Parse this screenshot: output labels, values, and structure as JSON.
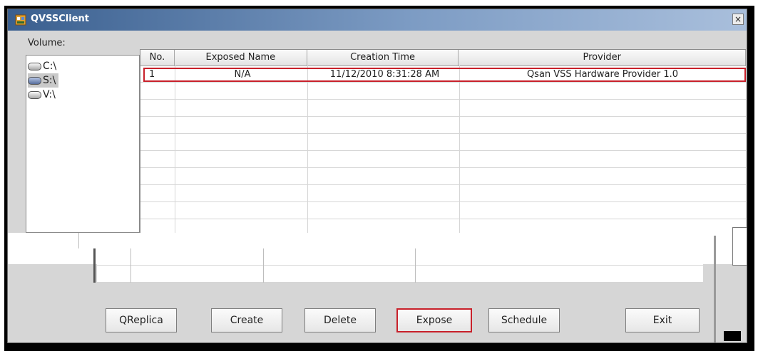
{
  "window": {
    "title": "QVSSClient",
    "close_glyph": "×",
    "accent_color": "#c8202a"
  },
  "volume_panel": {
    "label": "Volume:",
    "items": [
      {
        "label": "C:\\",
        "icon": "drive-icon",
        "selected": false
      },
      {
        "label": "S:\\",
        "icon": "drive-icon",
        "selected": true
      },
      {
        "label": "V:\\",
        "icon": "drive-icon",
        "selected": false
      }
    ]
  },
  "snapshot_table": {
    "columns": [
      "No.",
      "Exposed Name",
      "Creation Time",
      "Provider"
    ],
    "rows": [
      {
        "no": "1",
        "exposed_name": "N/A",
        "creation_time": "11/12/2010 8:31:28 AM",
        "provider": "Qsan VSS Hardware Provider 1.0"
      }
    ]
  },
  "buttons": {
    "qreplica": "QReplica",
    "create": "Create",
    "delete": "Delete",
    "expose": "Expose",
    "schedule": "Schedule",
    "exit": "Exit"
  }
}
